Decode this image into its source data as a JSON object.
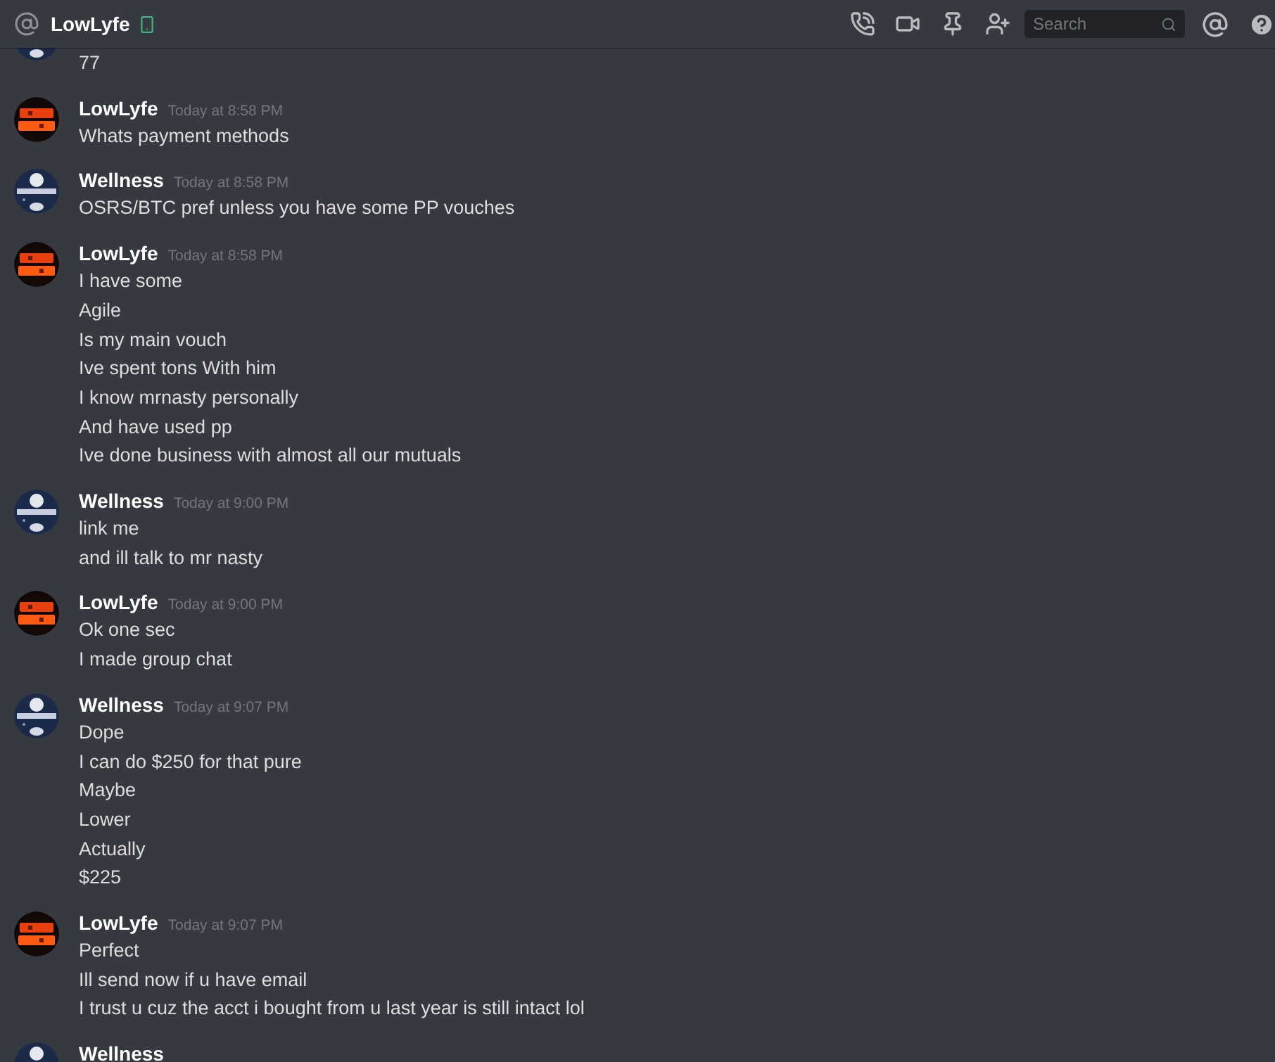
{
  "header": {
    "title": "LowLyfe",
    "search": {
      "placeholder": "Search"
    }
  },
  "messages": [
    {
      "kind": "wellness",
      "lines": [
        "77"
      ]
    },
    {
      "author": "LowLyfe",
      "kind": "panic",
      "time": "Today at 8:58 PM",
      "lines": [
        "Whats payment methods"
      ]
    },
    {
      "author": "Wellness",
      "kind": "wellness",
      "time": "Today at 8:58 PM",
      "lines": [
        "OSRS/BTC pref unless you have some PP vouches"
      ]
    },
    {
      "author": "LowLyfe",
      "kind": "panic",
      "time": "Today at 8:58 PM",
      "lines": [
        "I have some",
        "Agile",
        "Is my main vouch",
        "Ive spent tons With him",
        "I know mrnasty personally",
        "And have used pp",
        "Ive done business with almost all our mutuals"
      ]
    },
    {
      "author": "Wellness",
      "kind": "wellness",
      "time": "Today at 9:00 PM",
      "lines": [
        "link me",
        "and ill talk to mr nasty"
      ]
    },
    {
      "author": "LowLyfe",
      "kind": "panic",
      "time": "Today at 9:00 PM",
      "lines": [
        "Ok one sec",
        "I made group chat"
      ]
    },
    {
      "author": "Wellness",
      "kind": "wellness",
      "time": "Today at 9:07 PM",
      "lines": [
        "Dope",
        "I can do $250 for that pure",
        "Maybe",
        "Lower",
        "Actually",
        "$225"
      ]
    },
    {
      "author": "LowLyfe",
      "kind": "panic",
      "time": "Today at 9:07 PM",
      "lines": [
        "Perfect",
        "Ill send now if u have email",
        "I trust u cuz the acct i bought from u last year is still intact lol"
      ]
    },
    {
      "author": "Wellness",
      "kind": "wellness"
    }
  ]
}
